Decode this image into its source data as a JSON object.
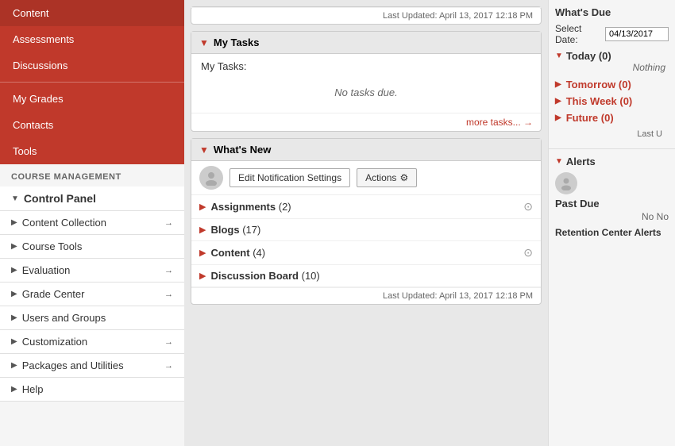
{
  "sidebar": {
    "top_items": [
      {
        "label": "Content",
        "id": "content"
      },
      {
        "label": "Assessments",
        "id": "assessments"
      },
      {
        "label": "Discussions",
        "id": "discussions"
      },
      {
        "label": "My Grades",
        "id": "my-grades"
      },
      {
        "label": "Contacts",
        "id": "contacts"
      },
      {
        "label": "Tools",
        "id": "tools"
      }
    ],
    "course_management_label": "COURSE MANAGEMENT",
    "control_panel_label": "Control Panel",
    "cp_items": [
      {
        "label": "Content Collection",
        "has_arrow": true,
        "id": "content-collection"
      },
      {
        "label": "Course Tools",
        "has_arrow": false,
        "id": "course-tools"
      },
      {
        "label": "Evaluation",
        "has_arrow": true,
        "id": "evaluation"
      },
      {
        "label": "Grade Center",
        "has_arrow": true,
        "id": "grade-center"
      },
      {
        "label": "Users and Groups",
        "has_arrow": false,
        "id": "users-groups"
      },
      {
        "label": "Customization",
        "has_arrow": true,
        "id": "customization"
      },
      {
        "label": "Packages and Utilities",
        "has_arrow": true,
        "id": "packages"
      },
      {
        "label": "Help",
        "has_arrow": false,
        "id": "help"
      }
    ]
  },
  "main": {
    "top_card": {
      "last_updated": "Last Updated: April 13, 2017 12:18 PM"
    },
    "my_tasks": {
      "title": "My Tasks",
      "tasks_label": "My Tasks:",
      "no_tasks_text": "No tasks due.",
      "more_tasks": "more tasks...",
      "last_updated": "Last Updated: April 13, 2017 12:18 PM"
    },
    "whats_new": {
      "title": "What's New",
      "edit_notification_btn": "Edit Notification Settings",
      "actions_btn": "Actions",
      "items": [
        {
          "label": "Assignments",
          "count": "(2)",
          "id": "assignments"
        },
        {
          "label": "Blogs",
          "count": "(17)",
          "id": "blogs"
        },
        {
          "label": "Content",
          "count": "(4)",
          "id": "content"
        },
        {
          "label": "Discussion Board",
          "count": "(10)",
          "id": "discussion-board"
        }
      ],
      "last_updated": "Last Updated: April 13, 2017 12:18 PM"
    }
  },
  "right_panel": {
    "whats_due": {
      "title": "What's Due",
      "select_date_label": "Select Date:",
      "select_date_value": "04/13/2017",
      "today_label": "Today (0)",
      "nothing_text": "Nothing",
      "tomorrow_label": "Tomorrow (0)",
      "this_week_label": "This Week (0)",
      "future_label": "Future (0)",
      "last_updated": "Last U"
    },
    "alerts": {
      "title": "Alerts",
      "past_due_label": "Past Due",
      "no_no_text": "No No",
      "retention_label": "Retention Center Alerts"
    }
  },
  "icons": {
    "collapse_down": "▼",
    "collapse_right": "▶",
    "arrow_right": "→",
    "gear": "⚙",
    "circle_down": "⊙",
    "user": "👤"
  }
}
